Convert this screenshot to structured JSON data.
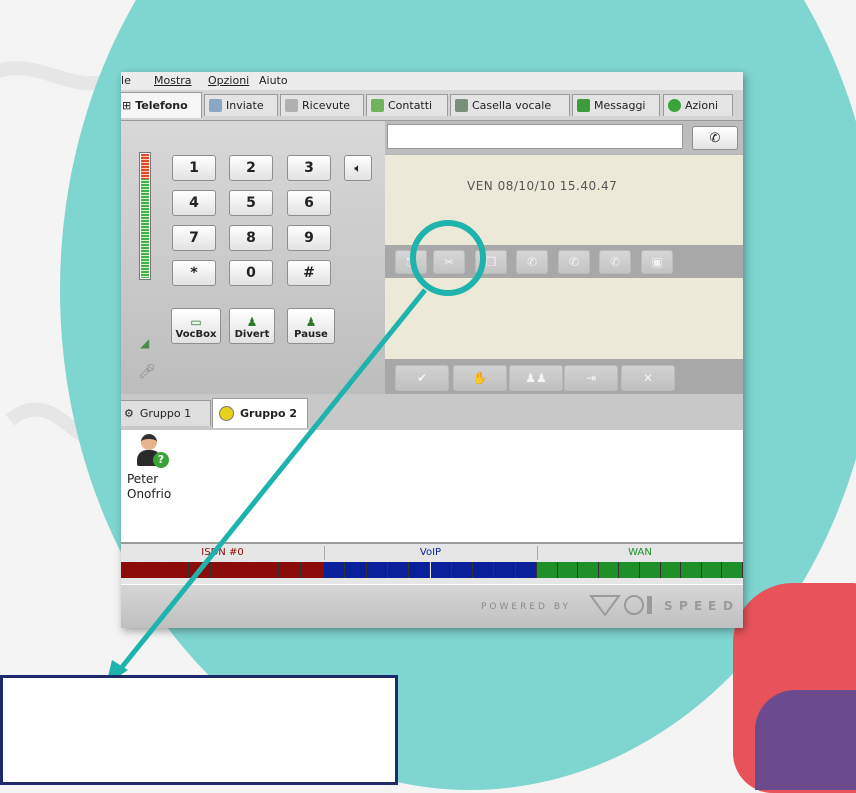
{
  "colors": {
    "teal_circle": "#7fd5d0",
    "callout_stroke": "#1fb3ad",
    "note_border": "#1f2a6a",
    "isdn": "#8b0b0b",
    "voip": "#0a1f9a",
    "wan": "#1f8f2a"
  },
  "menu": [
    {
      "label": "File",
      "shown": "ile"
    },
    {
      "label": "Mostra"
    },
    {
      "label": "Opzioni"
    },
    {
      "label": "Aiuto"
    }
  ],
  "tabs": [
    {
      "label": "Telefono",
      "icon": "keypad-grid-icon",
      "active": true
    },
    {
      "label": "Inviate",
      "icon": "outgoing-call-icon"
    },
    {
      "label": "Ricevute",
      "icon": "incoming-call-icon"
    },
    {
      "label": "Contatti",
      "icon": "contacts-icon"
    },
    {
      "label": "Casella vocale",
      "icon": "voicemail-icon"
    },
    {
      "label": "Messaggi",
      "icon": "messages-icon"
    },
    {
      "label": "Azioni",
      "icon": "clock-icon"
    }
  ],
  "keypad": [
    "1",
    "2",
    "3",
    "4",
    "5",
    "6",
    "7",
    "8",
    "9",
    "*",
    "0",
    "#"
  ],
  "function_buttons": [
    {
      "label": "VocBox",
      "icon": "voicebox-icon"
    },
    {
      "label": "Divert",
      "icon": "divert-icon"
    },
    {
      "label": "Pause",
      "icon": "pause-icon"
    }
  ],
  "display": {
    "number_value": "",
    "datetime": "VEN 08/10/10 15.40.47"
  },
  "call_controls": [
    "transfer-icon",
    "hangup-icon",
    "hold-icon",
    "redial-icon",
    "conference-icon",
    "forward-icon",
    "record-icon"
  ],
  "action_buttons": [
    "accept-icon",
    "hold-hand-icon",
    "group-icon",
    "exit-icon",
    "reject-icon"
  ],
  "groups": [
    {
      "label": "Gruppo 1",
      "icon": "gear-icon",
      "active": false
    },
    {
      "label": "Gruppo 2",
      "icon": "smiley-icon",
      "active": true
    }
  ],
  "contacts": [
    {
      "first": "Peter",
      "last": "Onofrio",
      "status_icon": "unknown-status-icon"
    }
  ],
  "status_lines": [
    {
      "label": "ISDN #0",
      "color": "#8b0b0b",
      "segments": 9
    },
    {
      "label": "VoIP",
      "color": "#0a1f9a",
      "segments": 10
    },
    {
      "label": "WAN",
      "color": "#1f8f2a",
      "segments": 10
    }
  ],
  "footer": {
    "powered_by": "POWERED BY",
    "brand_left": "VOI",
    "brand_right": "SPEED"
  }
}
